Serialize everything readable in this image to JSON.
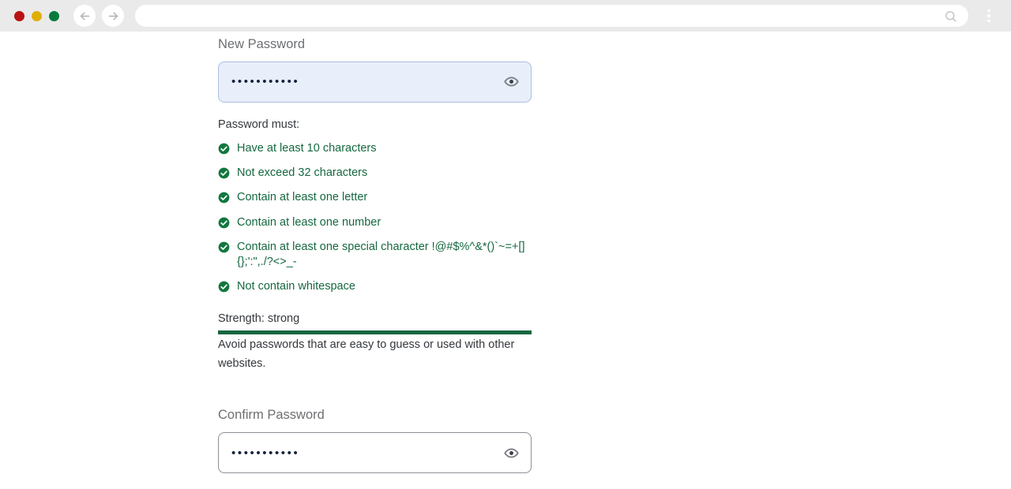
{
  "browser": {
    "traffic_lights": [
      {
        "name": "close",
        "color": "#b81212"
      },
      {
        "name": "minimize",
        "color": "#e0ae08"
      },
      {
        "name": "maximize",
        "color": "#047a3d"
      }
    ],
    "back_icon": "arrow-left-icon",
    "forward_icon": "arrow-right-icon",
    "address": {
      "value": "",
      "placeholder": ""
    },
    "search_icon": "search-icon",
    "menu_icon": "more-vertical-icon"
  },
  "form": {
    "new_password": {
      "label": "New Password",
      "value": "•••••••••••",
      "placeholder": "",
      "toggle_icon": "eye-icon",
      "focused": true
    },
    "requirements": {
      "title": "Password must:",
      "items": [
        {
          "icon": "check-circle-icon",
          "text": "Have at least 10 characters",
          "met": true
        },
        {
          "icon": "check-circle-icon",
          "text": "Not exceed 32 characters",
          "met": true
        },
        {
          "icon": "check-circle-icon",
          "text": "Contain at least one letter",
          "met": true
        },
        {
          "icon": "check-circle-icon",
          "text": "Contain at least one number",
          "met": true
        },
        {
          "icon": "check-circle-icon",
          "text": "Contain at least one special character !@#$%^&*()`~=+[]{};':\",./?<>_-",
          "met": true
        },
        {
          "icon": "check-circle-icon",
          "text": "Not contain whitespace",
          "met": true
        }
      ]
    },
    "strength": {
      "label": "Strength: strong",
      "level": "strong",
      "bar_percent": 100,
      "bar_color": "#15683f",
      "hint": "Avoid passwords that are easy to guess or used with other websites."
    },
    "confirm_password": {
      "label": "Confirm Password",
      "value": "•••••••••••",
      "placeholder": "",
      "toggle_icon": "eye-icon",
      "focused": false
    }
  },
  "colors": {
    "chrome_bg": "#eaeaea",
    "page_bg": "#ffffff",
    "label": "#6d6f72",
    "body_text": "#34383d",
    "success_green": "#15683f",
    "focus_fill": "#e8eefa",
    "focus_border": "#a9bfe0",
    "input_border": "#8d9096"
  }
}
